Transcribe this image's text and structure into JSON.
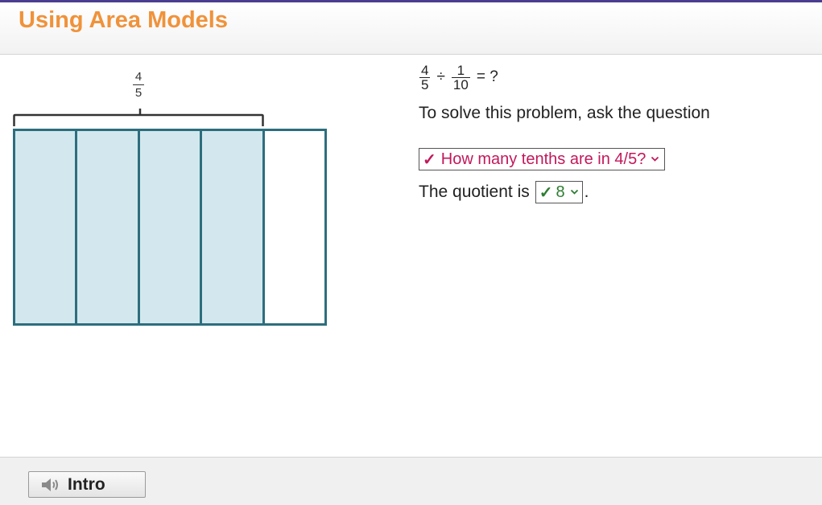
{
  "header": {
    "title": "Using Area Models"
  },
  "diagram": {
    "bracket_label": {
      "numerator": "4",
      "denominator": "5"
    },
    "columns": [
      {
        "shaded": true
      },
      {
        "shaded": true
      },
      {
        "shaded": true
      },
      {
        "shaded": true
      },
      {
        "shaded": false
      }
    ],
    "colors": {
      "shaded_fill": "#d3e8ee",
      "border": "#2d6e7e"
    }
  },
  "problem": {
    "equation": {
      "dividend": {
        "numerator": "4",
        "denominator": "5"
      },
      "operator": "÷",
      "divisor": {
        "numerator": "1",
        "denominator": "10"
      },
      "equals": "= ?"
    },
    "prompt": "To solve this problem, ask the question",
    "question_select": {
      "check": "✓",
      "value": "How many tenths are in 4/5?"
    },
    "quotient_label": "The quotient is",
    "quotient_select": {
      "check": "✓",
      "value": "8"
    },
    "period": "."
  },
  "footer": {
    "intro_label": "Intro",
    "intro_icon": "speaker-icon"
  },
  "colors": {
    "title": "#f0923a",
    "question_select": "#c2185b",
    "quotient_select": "#2e7d32",
    "top_stripe": "#4a3d8f"
  }
}
